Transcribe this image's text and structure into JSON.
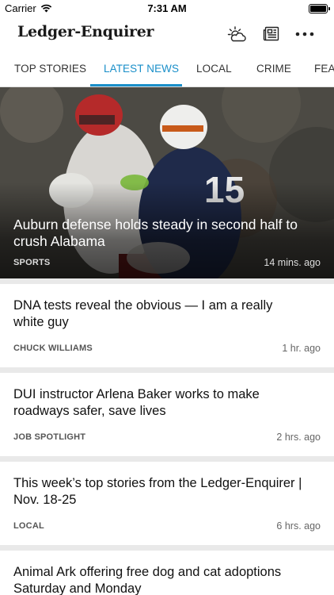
{
  "status_bar": {
    "carrier": "Carrier",
    "time": "7:31 AM"
  },
  "header": {
    "logo_text": "Ledger-Enquirer",
    "icons": [
      "weather-icon",
      "newspaper-icon",
      "more-icon"
    ]
  },
  "tabs": [
    {
      "label": "TOP STORIES",
      "active": false
    },
    {
      "label": "LATEST NEWS",
      "active": true
    },
    {
      "label": "LOCAL",
      "active": false
    },
    {
      "label": "CRIME",
      "active": false
    },
    {
      "label": "FEAT",
      "active": false
    }
  ],
  "hero": {
    "title": "Auburn defense holds steady in second half to crush Alabama",
    "category": "SPORTS",
    "time": "14 mins. ago"
  },
  "articles": [
    {
      "title": "DNA tests reveal the obvious — I am a really white guy",
      "byline": "CHUCK WILLIAMS",
      "time": "1 hr. ago"
    },
    {
      "title": "DUI instructor Arlena Baker works to make roadways safer, save lives",
      "byline": "JOB SPOTLIGHT",
      "time": "2 hrs. ago"
    },
    {
      "title": "This week’s top stories from the Ledger-Enquirer | Nov. 18-25",
      "byline": "LOCAL",
      "time": "6 hrs. ago"
    },
    {
      "title": "Animal Ark offering free dog and cat adoptions Saturday and Monday",
      "byline": "",
      "time": ""
    }
  ],
  "colors": {
    "accent": "#1a8fc9",
    "background": "#e9e9e9"
  }
}
